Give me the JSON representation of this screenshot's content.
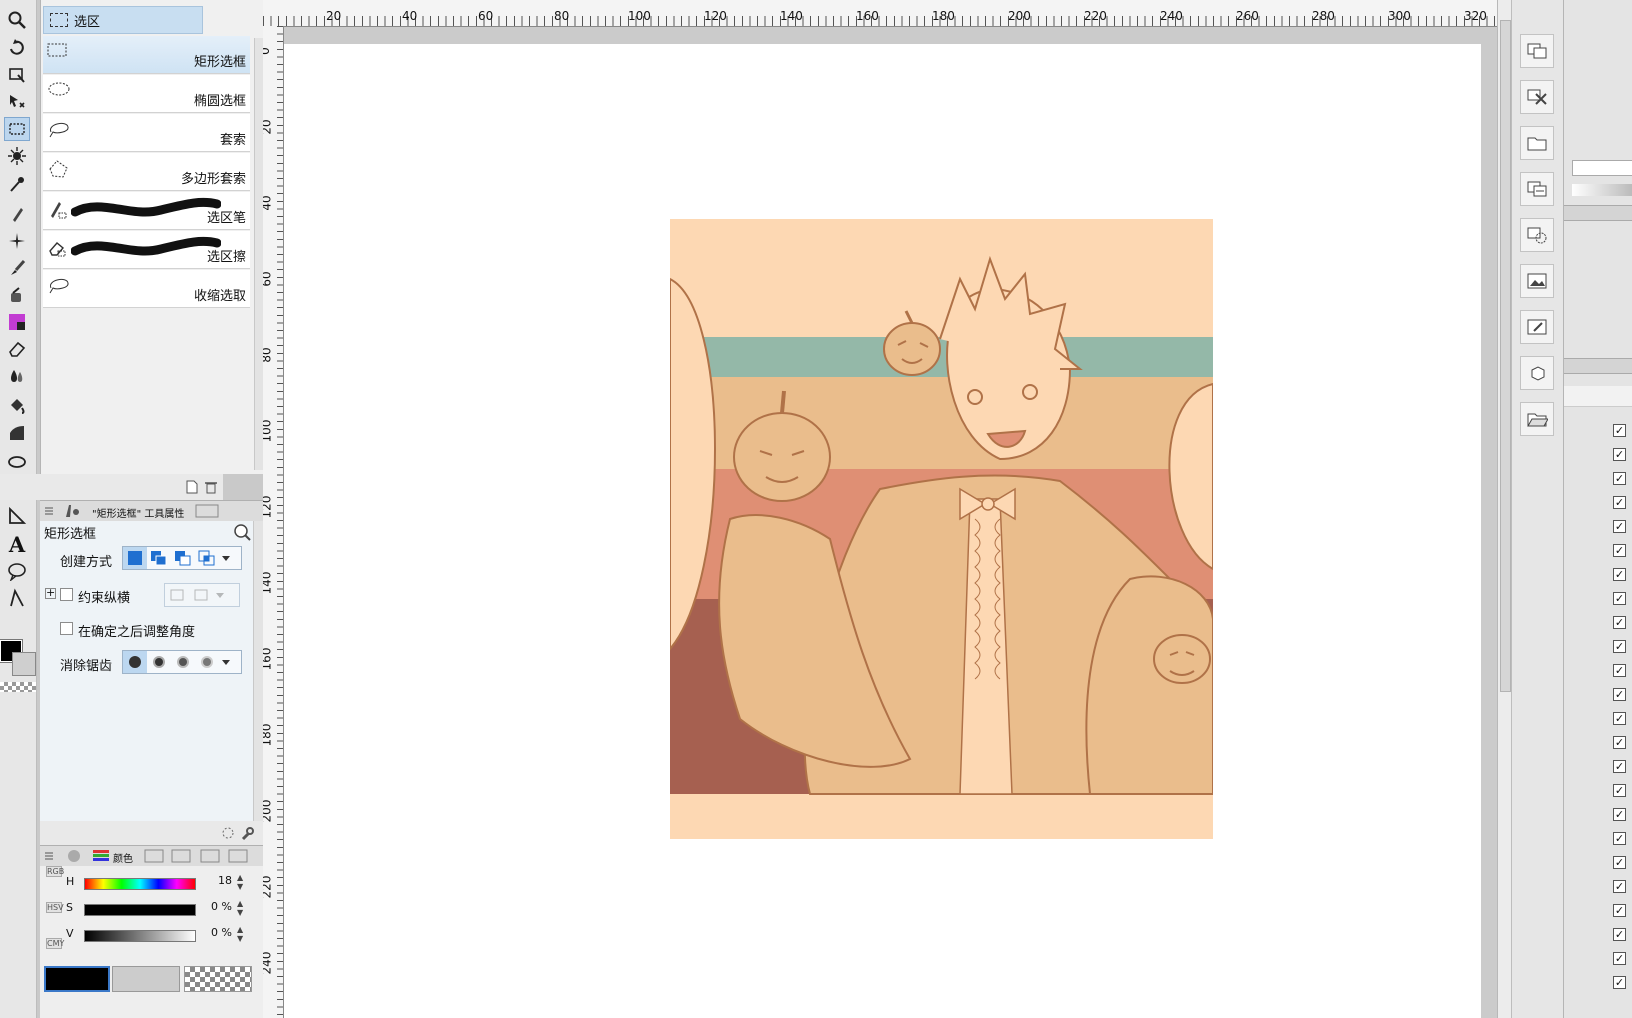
{
  "subtool": {
    "group_label": "选区",
    "items": [
      {
        "label": "矩形选框",
        "icon": "rect-selection-icon"
      },
      {
        "label": "椭圆选框",
        "icon": "ellipse-selection-icon"
      },
      {
        "label": "套索",
        "icon": "lasso-icon"
      },
      {
        "label": "多边形套索",
        "icon": "polygon-lasso-icon"
      },
      {
        "label": "选区笔",
        "icon": "selection-pen-icon"
      },
      {
        "label": "选区擦",
        "icon": "selection-eraser-icon"
      },
      {
        "label": "收缩选取",
        "icon": "shrink-selection-icon"
      }
    ]
  },
  "tool_property": {
    "tab_label": "\"矩形选框\" 工具属性",
    "title": "矩形选框",
    "create_mode_label": "创建方式",
    "constrain_label": "约束纵横",
    "adjust_angle_label": "在确定之后调整角度",
    "antialias_label": "消除锯齿"
  },
  "color_panel": {
    "tab_label": "颜色",
    "modes": [
      "RGB",
      "HSV",
      "CMY"
    ],
    "h": {
      "label": "H",
      "value": "18"
    },
    "s": {
      "label": "S",
      "value": "0 %"
    },
    "v": {
      "label": "V",
      "value": "0 %"
    },
    "main_color": "#000000",
    "sub_color": "#cccccc"
  },
  "ruler": {
    "top_ticks": [
      "20",
      "40",
      "60",
      "80",
      "100",
      "120",
      "140",
      "160",
      "180",
      "200",
      "220",
      "240",
      "260",
      "280",
      "300",
      "320"
    ],
    "left_ticks": [
      "0",
      "20",
      "40",
      "60",
      "80",
      "100",
      "120",
      "140",
      "160",
      "180",
      "200",
      "220",
      "240"
    ]
  },
  "colors": {
    "artwork_bg": "#fdd8b3",
    "stripe_teal": "#94b8a8",
    "stripe_tan": "#eabd8c",
    "stripe_coral": "#df8f74",
    "stripe_dark": "#a66050",
    "line": "#b07248",
    "selection_blue": "#c8def1"
  }
}
